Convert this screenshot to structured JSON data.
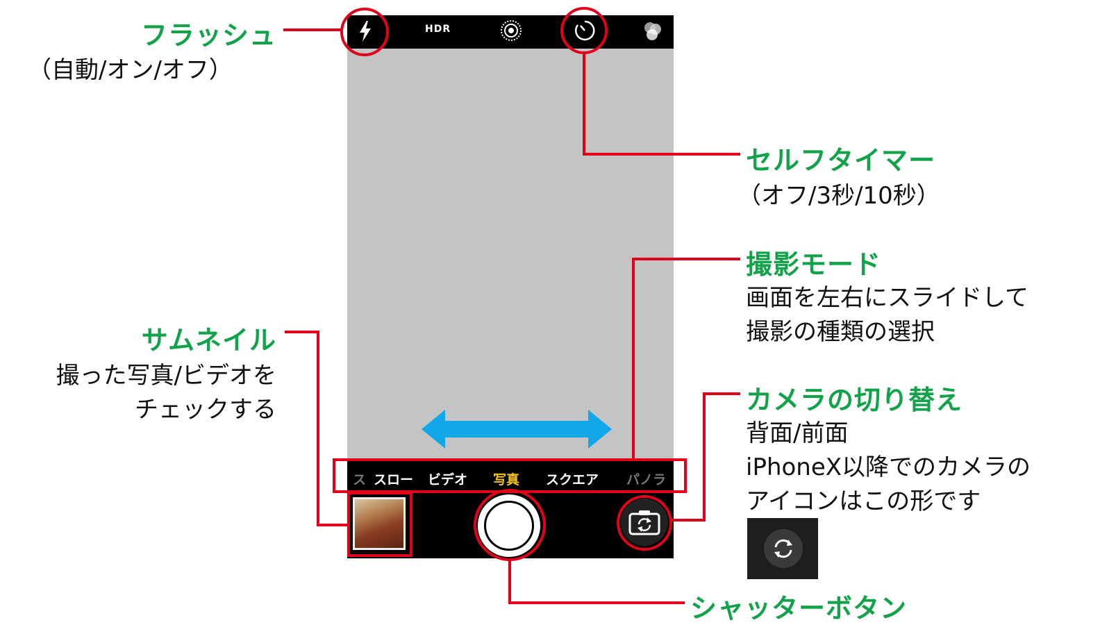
{
  "camera": {
    "hdr_label": "HDR",
    "modes": [
      {
        "label": "ス",
        "state": "faded"
      },
      {
        "label": "スロー",
        "state": "normal"
      },
      {
        "label": "ビデオ",
        "state": "normal"
      },
      {
        "label": "写真",
        "state": "active"
      },
      {
        "label": "スクエア",
        "state": "normal"
      },
      {
        "label": "パノラ",
        "state": "faded"
      }
    ],
    "active_mode_color": "#f5c41b",
    "icons": [
      "flash-icon",
      "hdr-label",
      "live-photo-icon",
      "timer-icon",
      "filter-icon",
      "thumbnail",
      "shutter-button",
      "camera-switch-icon"
    ]
  },
  "annotations": {
    "flash": {
      "title": "フラッシュ",
      "desc": "（自動/オン/オフ）"
    },
    "timer": {
      "title": "セルフタイマー",
      "desc": "（オフ/3秒/10秒）"
    },
    "mode": {
      "title": "撮影モード",
      "desc_line1": "画面を左右にスライドして",
      "desc_line2": "撮影の種類の選択"
    },
    "thumbnail": {
      "title": "サムネイル",
      "desc_line1": "撮った写真/ビデオを",
      "desc_line2": "チェックする"
    },
    "switch": {
      "title": "カメラの切り替え",
      "desc_line1": "背面/前面",
      "desc_line2": "iPhoneX以降でのカメラの",
      "desc_line3": "アイコンはこの形です"
    },
    "shutter": {
      "title": "シャッターボタン"
    }
  },
  "colors": {
    "title_green": "#12a24a",
    "callout_red": "#e3001b",
    "swipe_arrow_blue": "#10a8e8"
  }
}
